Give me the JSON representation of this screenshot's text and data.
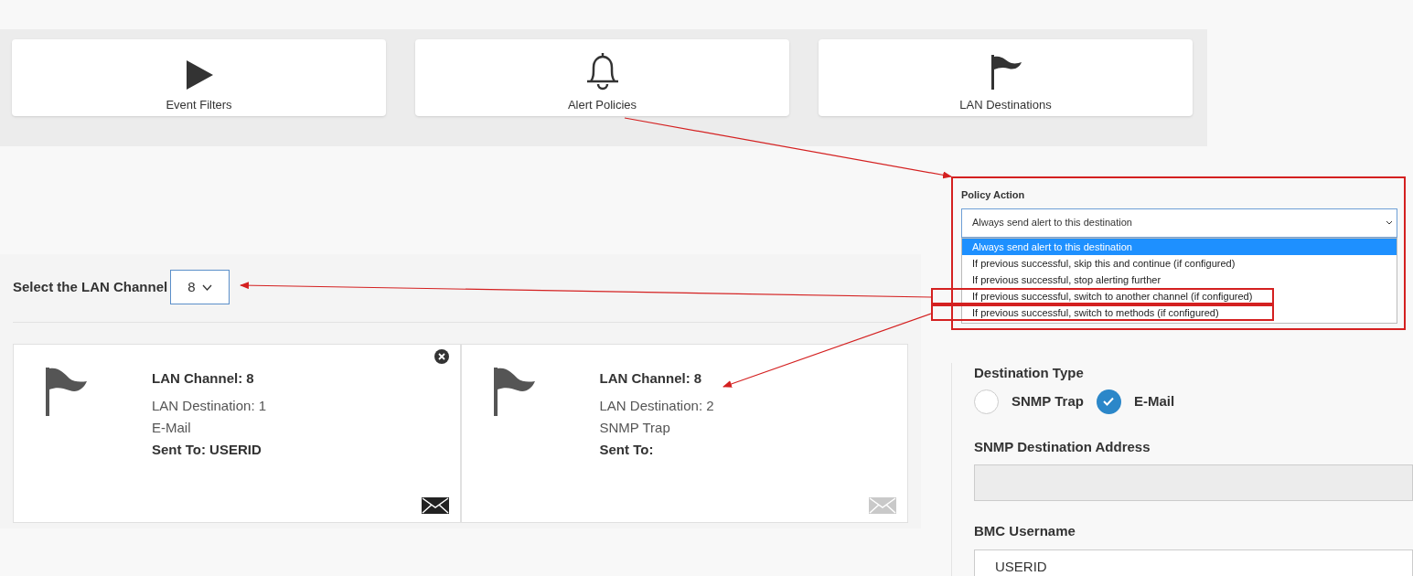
{
  "tiles": [
    {
      "label": "Event Filters",
      "kind": "play"
    },
    {
      "label": "Alert Policies",
      "kind": "bell"
    },
    {
      "label": "LAN Destinations",
      "kind": "flag"
    }
  ],
  "channel_selector": {
    "label": "Select the LAN Channel",
    "value": "8"
  },
  "destinations": [
    {
      "channel": "LAN Channel: 8",
      "destination": "LAN Destination: 1",
      "type": "E-Mail",
      "sent_to": "Sent To: USERID",
      "removable": true,
      "mail_active": true
    },
    {
      "channel": "LAN Channel: 8",
      "destination": "LAN Destination: 2",
      "type": "SNMP Trap",
      "sent_to": "Sent To:",
      "removable": false,
      "mail_active": false
    }
  ],
  "policy_action": {
    "label": "Policy Action",
    "value": "Always send alert to this destination",
    "options": [
      {
        "label": "Always send alert to this destination",
        "selected": true,
        "highlighted": false
      },
      {
        "label": "If previous successful, skip this and continue (if configured)",
        "selected": false,
        "highlighted": false
      },
      {
        "label": "If previous successful, stop alerting further",
        "selected": false,
        "highlighted": false
      },
      {
        "label": "If previous successful, switch to another channel (if configured)",
        "selected": false,
        "highlighted": true
      },
      {
        "label": "If previous successful, switch to methods (if configured)",
        "selected": false,
        "highlighted": true
      }
    ]
  },
  "destination_form": {
    "type_label": "Destination Type",
    "types": [
      {
        "label": "SNMP Trap",
        "selected": false
      },
      {
        "label": "E-Mail",
        "selected": true
      }
    ],
    "address": {
      "label": "SNMP Destination Address",
      "disabled": true
    },
    "username": {
      "label": "BMC Username",
      "value": "USERID"
    }
  }
}
